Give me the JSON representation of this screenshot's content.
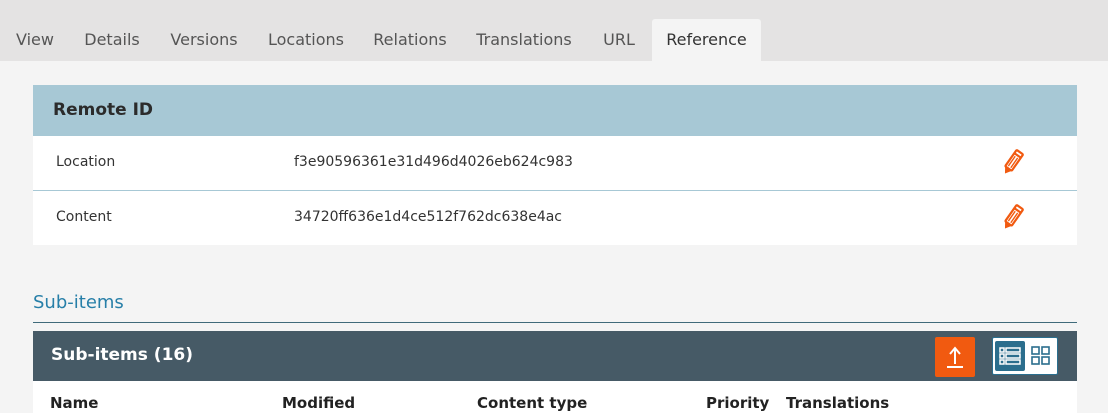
{
  "tabs": [
    {
      "label": "View"
    },
    {
      "label": "Details"
    },
    {
      "label": "Versions"
    },
    {
      "label": "Locations"
    },
    {
      "label": "Relations"
    },
    {
      "label": "Translations"
    },
    {
      "label": "URL"
    },
    {
      "label": "Reference",
      "active": true
    }
  ],
  "remote_id": {
    "title": "Remote ID",
    "rows": [
      {
        "label": "Location",
        "value": "f3e90596361e31d496d4026eb624c983",
        "action_icon": "pencil-icon"
      },
      {
        "label": "Content",
        "value": "34720ff636e1d4ce512f762dc638e4ac",
        "action_icon": "pencil-icon"
      }
    ]
  },
  "subitems": {
    "section_title": "Sub-items",
    "header_title": "Sub-items (16)",
    "upload_icon": "upload-icon",
    "view_modes": [
      "list-view-icon",
      "grid-view-icon"
    ],
    "columns": [
      "Name",
      "Modified",
      "Content type",
      "Priority",
      "Translations"
    ]
  },
  "colors": {
    "accent_orange": "#f15a10",
    "header_blue": "#a7c8d5",
    "dark_header": "#465a66",
    "link_blue": "#277fa8"
  }
}
